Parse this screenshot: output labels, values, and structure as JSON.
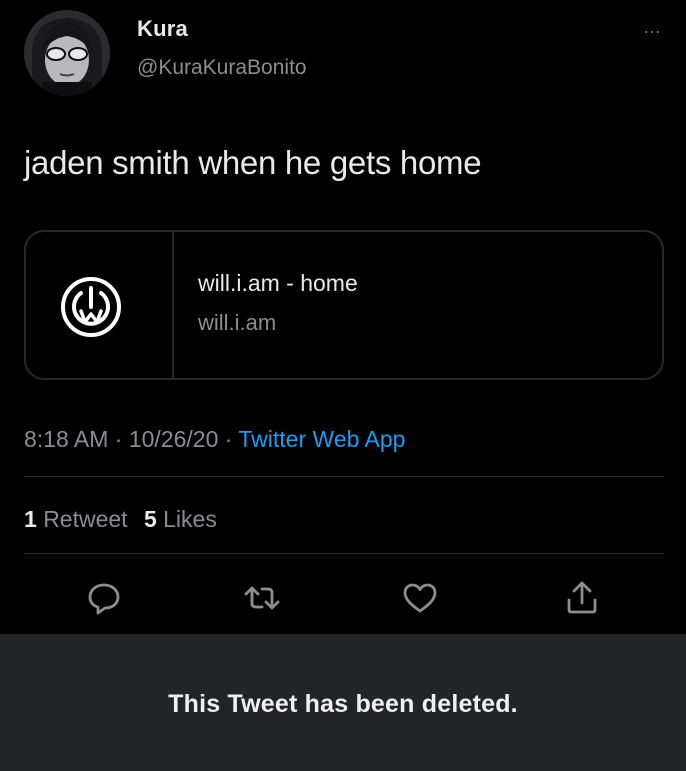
{
  "tweet": {
    "display_name": "Kura",
    "handle": "@KuraKuraBonito",
    "more_icon": "…",
    "text": "jaden smith when he gets home",
    "card": {
      "logo_icon": "will-i-am-logo-icon",
      "title": "will.i.am - home",
      "subtitle": "will.i.am"
    },
    "meta": {
      "time": "8:18 AM",
      "separator": " · ",
      "date": "10/26/20",
      "source": "Twitter Web App"
    },
    "stats": {
      "retweets_count": "1",
      "retweets_label": "Retweet",
      "likes_count": "5",
      "likes_label": "Likes"
    },
    "actions": [
      "reply-icon",
      "retweet-icon",
      "like-icon",
      "share-icon"
    ]
  },
  "deleted_notice": {
    "text": "This Tweet has been deleted."
  },
  "colors": {
    "background": "#000000",
    "text_primary": "#e7e9ea",
    "text_secondary": "#8b8d91",
    "accent": "#1d9bf0",
    "deleted_bar": "#232427"
  }
}
